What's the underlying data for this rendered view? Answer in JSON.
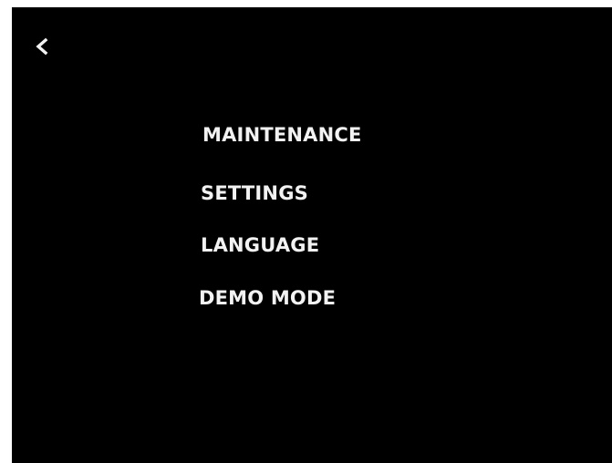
{
  "header": {
    "back_icon": "chevron-left-icon"
  },
  "menu": {
    "items": [
      {
        "label": "MAINTENANCE"
      },
      {
        "label": "SETTINGS"
      },
      {
        "label": "LANGUAGE"
      },
      {
        "label": "DEMO MODE"
      }
    ]
  },
  "colors": {
    "background": "#000000",
    "text": "#f2f2f2",
    "outer_border": "#ffffff"
  }
}
